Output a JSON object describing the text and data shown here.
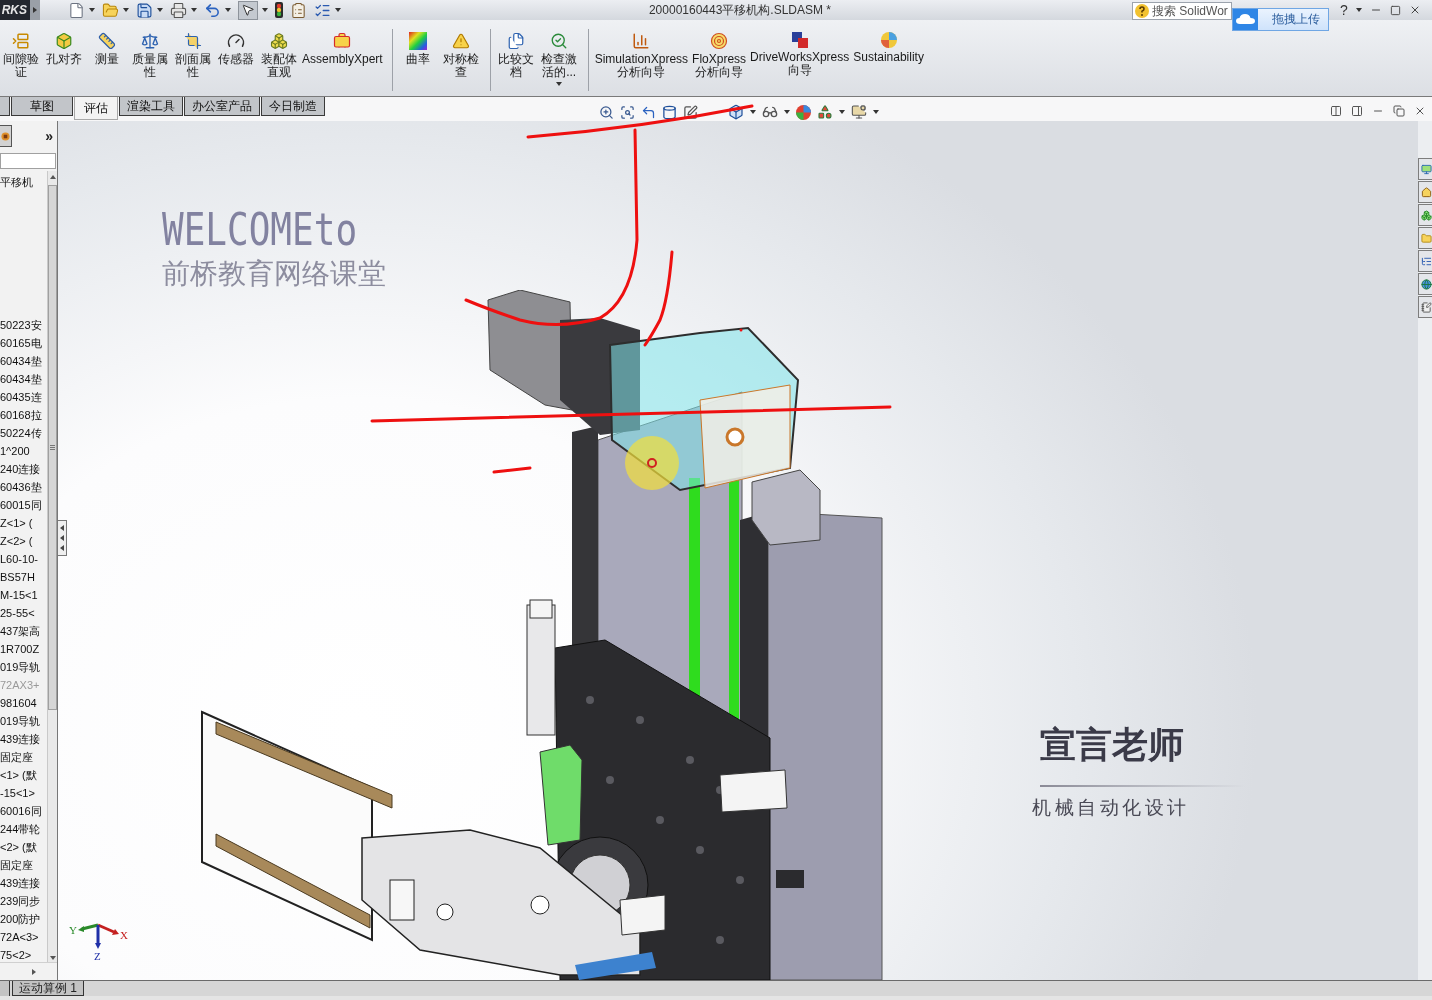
{
  "title_bar": {
    "logo": "RKS",
    "document_title": "20000160443平移机构.SLDASM *",
    "search": {
      "placeholder": "搜索 SolidWor"
    },
    "help": "?"
  },
  "upload_popup": {
    "label": "拖拽上传"
  },
  "ribbon": {
    "groups": [
      {
        "buttons": [
          {
            "label": "间隙验证",
            "dropdown": false
          },
          {
            "label": "孔对齐",
            "dropdown": false
          },
          {
            "label": "测量",
            "dropdown": false
          },
          {
            "label": "质量属性",
            "dropdown": false
          },
          {
            "label": "剖面属性",
            "dropdown": false
          },
          {
            "label": "传感器",
            "dropdown": false
          },
          {
            "label": "装配体直观",
            "dropdown": false
          },
          {
            "label": "AssemblyXpert",
            "dropdown": false
          }
        ]
      },
      {
        "buttons": [
          {
            "label": "曲率",
            "dropdown": false
          },
          {
            "label": "对称检查",
            "dropdown": false
          }
        ]
      },
      {
        "buttons": [
          {
            "label": "比较文档",
            "dropdown": false
          },
          {
            "label": "检查激活的...",
            "dropdown": true
          }
        ]
      },
      {
        "buttons": [
          {
            "label": "SimulationXpress 分析向导",
            "dropdown": false
          },
          {
            "label": "FloXpress 分析向导",
            "dropdown": false
          },
          {
            "label": "DriveWorksXpress 向导",
            "dropdown": false
          },
          {
            "label": "Sustainability",
            "dropdown": false
          }
        ]
      }
    ]
  },
  "command_tabs": [
    {
      "label": "草图",
      "selected": false
    },
    {
      "label": "评估",
      "selected": true
    },
    {
      "label": "渲染工具",
      "selected": false
    },
    {
      "label": "办公室产品",
      "selected": false
    },
    {
      "label": "今日制造",
      "selected": false
    }
  ],
  "feature_manager": {
    "more": "»",
    "tree": {
      "root": "平移机",
      "items": [
        {
          "name": "50223安",
          "suppressed": false
        },
        {
          "name": "60165电",
          "suppressed": false
        },
        {
          "name": "60434垫",
          "suppressed": false
        },
        {
          "name": "60434垫",
          "suppressed": false
        },
        {
          "name": "60435连",
          "suppressed": false
        },
        {
          "name": "60168拉",
          "suppressed": false
        },
        {
          "name": "50224传",
          "suppressed": false
        },
        {
          "name": "1^200",
          "suppressed": false
        },
        {
          "name": "240连接",
          "suppressed": false
        },
        {
          "name": "60436垫",
          "suppressed": false
        },
        {
          "name": "60015同",
          "suppressed": false
        },
        {
          "name": "Z<1> (",
          "suppressed": false
        },
        {
          "name": "Z<2> (",
          "suppressed": false
        },
        {
          "name": "L60-10-",
          "suppressed": false
        },
        {
          "name": "BS57H",
          "suppressed": false
        },
        {
          "name": "M-15<1",
          "suppressed": false
        },
        {
          "name": "25-55<",
          "suppressed": false
        },
        {
          "name": "437架高",
          "suppressed": false
        },
        {
          "name": "1R700Z",
          "suppressed": false
        },
        {
          "name": "019导轨",
          "suppressed": false
        },
        {
          "name": "72AX3+",
          "suppressed": true
        },
        {
          "name": "981604",
          "suppressed": false
        },
        {
          "name": "019导轨",
          "suppressed": false
        },
        {
          "name": "439连接",
          "suppressed": false
        },
        {
          "name": "固定座",
          "suppressed": false
        },
        {
          "name": "<1> (默",
          "suppressed": false
        },
        {
          "name": "-15<1>",
          "suppressed": false
        },
        {
          "name": "60016同",
          "suppressed": false
        },
        {
          "name": "244带轮",
          "suppressed": false
        },
        {
          "name": "<2> (默",
          "suppressed": false
        },
        {
          "name": "固定座",
          "suppressed": false
        },
        {
          "name": "439连接",
          "suppressed": false
        },
        {
          "name": "239同步",
          "suppressed": false
        },
        {
          "name": "200防护",
          "suppressed": false
        },
        {
          "name": "72A<3>",
          "suppressed": false
        },
        {
          "name": "75<2>",
          "suppressed": false
        }
      ]
    }
  },
  "viewport": {
    "welcome": {
      "line_1": "WELCOMEto",
      "line_2": "前桥教育网络课堂"
    },
    "signature": {
      "name": "宣言老师",
      "subtitle": "机械自动化设计"
    },
    "triad": {
      "x": "X",
      "y": "Y",
      "z": "Z"
    }
  },
  "bottom_tabs": [
    {
      "label": "运动算例 1",
      "selected": false
    }
  ]
}
